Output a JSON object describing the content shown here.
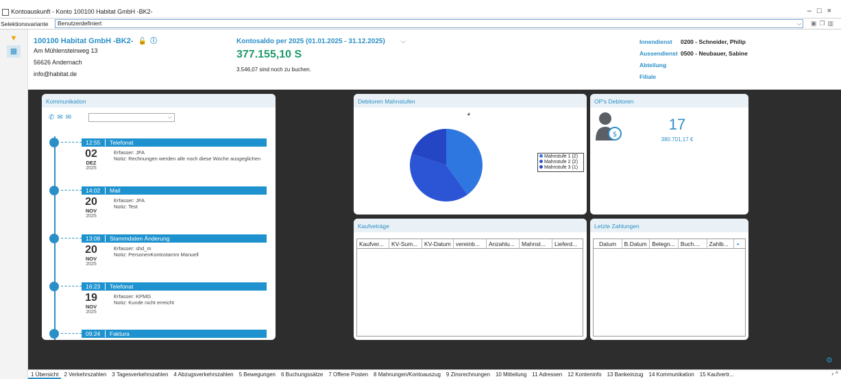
{
  "window": {
    "title": "Kontoauskunft - Konto 100100 Habitat GmbH -BK2-",
    "controls": [
      "–",
      "□",
      "×"
    ]
  },
  "selection": {
    "label": "Selektionsvariante",
    "value": "Benutzerdefiniert"
  },
  "header": {
    "name": "100100 Habitat GmbH -BK2-",
    "street": "Am Mühlensteinweg 13",
    "city": "56626 Andernach",
    "email": "info@habitat.de",
    "saldo_label": "Kontosaldo per 2025 (01.01.2025 - 31.12.2025)",
    "saldo_value": "377.155,10 S",
    "booking_note": "3.546,07 sind noch zu buchen.",
    "innendienst_label": "Innendienst",
    "innendienst_value": "0200 - Schneider, Philip",
    "aussendienst_label": "Aussendienst",
    "aussendienst_value": "0500 - Neubauer, Sabine",
    "abteilung_label": "Abteilung",
    "filiale_label": "Filiale"
  },
  "kommunikation": {
    "title": "Kommunikation",
    "entries": [
      {
        "time": "12:55",
        "type": "Telefonat",
        "day": "02",
        "month": "DEZ",
        "year": "2025",
        "erfasser": "Erfasser: JFA",
        "notiz": "Notiz: Rechnungen werden alle noch diese Woche ausgeglichen"
      },
      {
        "time": "14:02",
        "type": "Mail",
        "day": "20",
        "month": "NOV",
        "year": "2025",
        "erfasser": "Erfasser: JFA",
        "notiz": "Notiz: Test"
      },
      {
        "time": "13:08",
        "type": "Stammdaten Änderung",
        "day": "20",
        "month": "NOV",
        "year": "2025",
        "erfasser": "Erfasser: shd_m",
        "notiz": "Notiz: PersonenKontostamm Manuell"
      },
      {
        "time": "16:23",
        "type": "Telefonat",
        "day": "19",
        "month": "NOV",
        "year": "2025",
        "erfasser": "Erfasser: KPMG",
        "notiz": "Notiz: Kunde nicht erreicht"
      },
      {
        "time": "09:24",
        "type": "Faktura"
      }
    ]
  },
  "debitoren": {
    "title": "Debitoren Mahnstufen",
    "legend": [
      "Mahnstufe 1 (2)",
      "Mahnstufe 2 (2)",
      "Mahnstufe 3 (1)"
    ]
  },
  "chart_data": {
    "type": "pie",
    "title": "Debitoren Mahnstufen",
    "categories": [
      "Mahnstufe 1 (2)",
      "Mahnstufe 2 (2)",
      "Mahnstufe 3 (1)"
    ],
    "values": [
      2,
      2,
      1
    ],
    "colors": [
      "#2f77e0",
      "#2c55d6",
      "#2446c4"
    ],
    "legend_position": "right"
  },
  "ops": {
    "title": "OP's Debitoren",
    "count": "17",
    "amount": "380.701,17 €"
  },
  "kaufvertraege": {
    "title": "Kaufveträge",
    "columns": [
      "Kaufver...",
      "KV-Sum...",
      "KV-Datum",
      "vereinb...",
      "Anzahlu...",
      "Mahnst...",
      "Lieferd..."
    ]
  },
  "zahlungen": {
    "title": "Letzte Zahlungen",
    "columns": [
      "Datum",
      "B.Datum",
      "Belegn...",
      "Buch....",
      "Zahlb..."
    ]
  },
  "tabs": [
    "1 Übersicht",
    "2 Verkehrszahlen",
    "3 Tagesverkehrszahlen",
    "4 Abzugsverkehrszahlen",
    "5 Bewegungen",
    "6 Buchungssätze",
    "7 Offene Posten",
    "8 Mahnungen/Kontoauszug",
    "9 Zinsrechnungen",
    "10 Mitteilung",
    "11 Adressen",
    "12 Konteninfo",
    "13 Bankeinzug",
    "14 Kommunikation",
    "15 Kaufvertr..."
  ]
}
